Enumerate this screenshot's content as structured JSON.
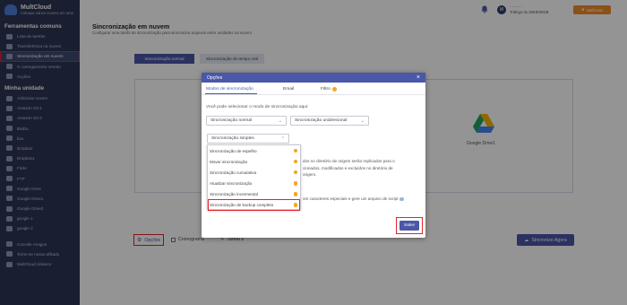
{
  "app": {
    "name": "MultCloud",
    "tagline": "Coloque vários nuvens em uma"
  },
  "sidebar": {
    "section_common": "Ferramentas comuns",
    "common_items": [
      {
        "label": "Lista de tarefas",
        "icon": "list-icon"
      },
      {
        "label": "Transferência na nuvem",
        "icon": "cloud-transfer-icon"
      },
      {
        "label": "Sincronização em nuvem",
        "icon": "cloud-sync-icon",
        "active": true
      },
      {
        "label": "O carregamento remoto",
        "icon": "remote-upload-icon"
      },
      {
        "label": "Acções",
        "icon": "actions-icon"
      }
    ],
    "section_drives": "Minha unidade",
    "drive_items": [
      {
        "label": "Adicionar nuvem",
        "icon": "add-cloud-icon"
      },
      {
        "label": "Amazon S3-1",
        "icon": "amazon-s3-icon"
      },
      {
        "label": "Amazon S3-2",
        "icon": "amazon-s3-icon"
      },
      {
        "label": "BaiDu",
        "icon": "baidu-icon"
      },
      {
        "label": "box",
        "icon": "box-icon"
      },
      {
        "label": "Dropbox",
        "icon": "dropbox-icon"
      },
      {
        "label": "Dropbox1",
        "icon": "dropbox-icon"
      },
      {
        "label": "Flickr",
        "icon": "flickr-icon"
      },
      {
        "label": "FTP",
        "icon": "ftp-icon"
      },
      {
        "label": "Google Drive",
        "icon": "google-drive-icon"
      },
      {
        "label": "Google Drive1",
        "icon": "google-drive-icon"
      },
      {
        "label": "Google Drive2",
        "icon": "google-drive-icon"
      },
      {
        "label": "google 1",
        "icon": "google-photos-icon"
      },
      {
        "label": "google 2",
        "icon": "google-photos-icon"
      }
    ],
    "bottom_items": [
      {
        "label": "Convide Amigos",
        "icon": "invite-icon"
      },
      {
        "label": "Torne-se nosso afiliado",
        "icon": "affiliate-icon"
      },
      {
        "label": "MultCloud clássico",
        "icon": "classic-icon"
      }
    ]
  },
  "header": {
    "avatar_letter": "M",
    "user_line1": "··········",
    "user_line2": "Tráfego:31.30KB/30GB",
    "upgrade_label": "Melhorar"
  },
  "page": {
    "title": "Sincronização em nuvem",
    "subtitle": "Configurar uma tarefa de sincronização para sincronizar arquivos entre unidades na nuvem",
    "tab_normal": "Sincronização normal",
    "tab_realtime": "Sincronização de tempo real",
    "target_label": "Google Drive1",
    "options_label": "Opções",
    "schedule_label": "Cronograma",
    "task_label": "Tarefa 9",
    "sync_now_label": "Sincronize Agora"
  },
  "modal": {
    "title": "Opções",
    "tabs": [
      "Modos de sincronização",
      "Email",
      "Filtro"
    ],
    "intro": "Você pode selecionar o modo de sincronização aqui:",
    "select_mode": "Sincronização normal",
    "select_direction": "Sincronização unidirecional",
    "select_sub": "Sincronização simples",
    "dropdown_options": [
      "Sincronização de espelho",
      "Mover sincronização",
      "Sincronização cumulativa",
      "Atualizar sincronização",
      "Sincronização incremental",
      "Sincronização de backup completo"
    ],
    "bg_text_1": "dos no diretório de origem serão replicados para o",
    "bg_text_2": "cionados, modificados e excluídos no diretório de",
    "bg_text_3": "origem.",
    "bg_text_4": "om caracteres especiais e gere um arquivo de script",
    "save_label": "Salve"
  },
  "colors": {
    "sidebar_bg": "#2b3553",
    "accent": "#4b57a8",
    "upgrade": "#f28c28",
    "highlight": "#e0262b"
  }
}
